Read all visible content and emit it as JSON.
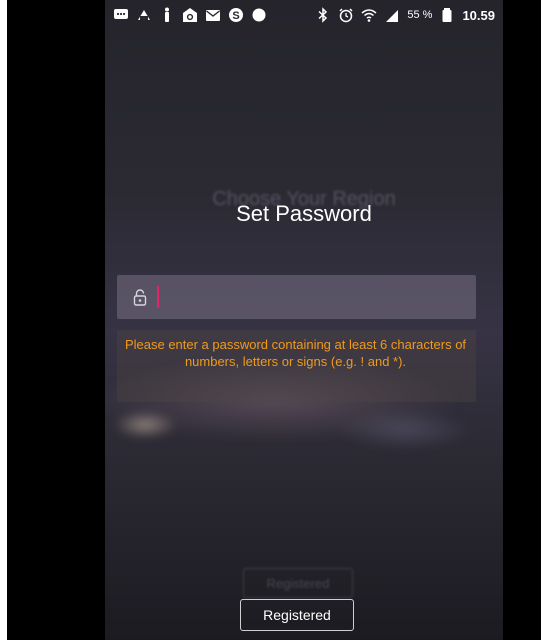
{
  "status_bar": {
    "left_icons": [
      "chat-icon",
      "notification-icon",
      "info-icon",
      "mail-at-icon",
      "mail-icon",
      "skype-icon",
      "dot-icon"
    ],
    "right_icons": [
      "bluetooth-icon",
      "alarm-icon",
      "wifi-icon",
      "signal-icon",
      "battery-icon"
    ],
    "battery_text": "55 %",
    "time": "10.59"
  },
  "screen": {
    "ghost_title": "Choose Your Region",
    "title": "Set Password",
    "password_field": {
      "value": "",
      "placeholder": ""
    },
    "hint": "Please enter a password containing at least 6 characters of numbers, letters or signs (e.g. ! and *).",
    "ghost_button_label": "Registered",
    "register_button_label": "Registered"
  },
  "colors": {
    "hint": "#f19a1b",
    "caret": "#e3236a",
    "title": "#ffffff"
  }
}
